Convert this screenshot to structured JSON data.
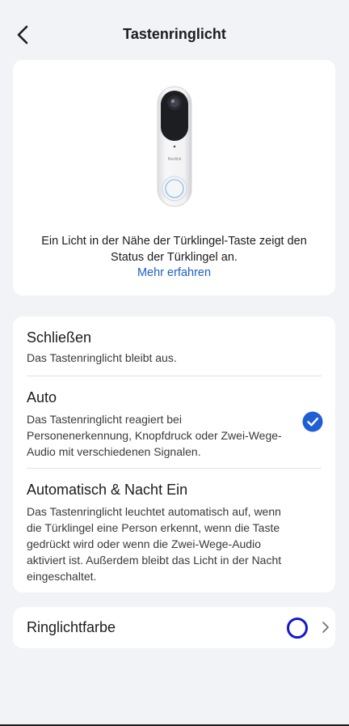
{
  "header": {
    "title": "Tastenringlicht",
    "back_icon": "chevron-left-icon"
  },
  "device_card": {
    "image": "doorbell-image",
    "brand_text": "Reolink",
    "description": "Ein Licht in der Nähe der Türklingel-Taste zeigt den Status der Türklingel an.",
    "learn_more": "Mehr erfahren"
  },
  "options": [
    {
      "title": "Schließen",
      "description": "Das Tastenringlicht bleibt aus.",
      "selected": false
    },
    {
      "title": "Auto",
      "description": "Das Tastenringlicht reagiert bei Personenerkennung, Knopfdruck oder Zwei-Wege-Audio mit verschiedenen Signalen.",
      "selected": true
    },
    {
      "title": "Automatisch & Nacht Ein",
      "description": "Das Tastenringlicht leuchtet automatisch auf, wenn die Türklingel eine Person erkennt, wenn die Taste gedrückt wird oder wenn die Zwei-Wege-Audio aktiviert ist. Außerdem bleibt das Licht in der Nacht eingeschaltet.",
      "selected": false
    }
  ],
  "ring_color": {
    "label": "Ringlichtfarbe",
    "color": "#1414d8"
  },
  "colors": {
    "accent": "#1a60c9",
    "check": "#1f5fd6",
    "background": "#f2f3f7"
  }
}
